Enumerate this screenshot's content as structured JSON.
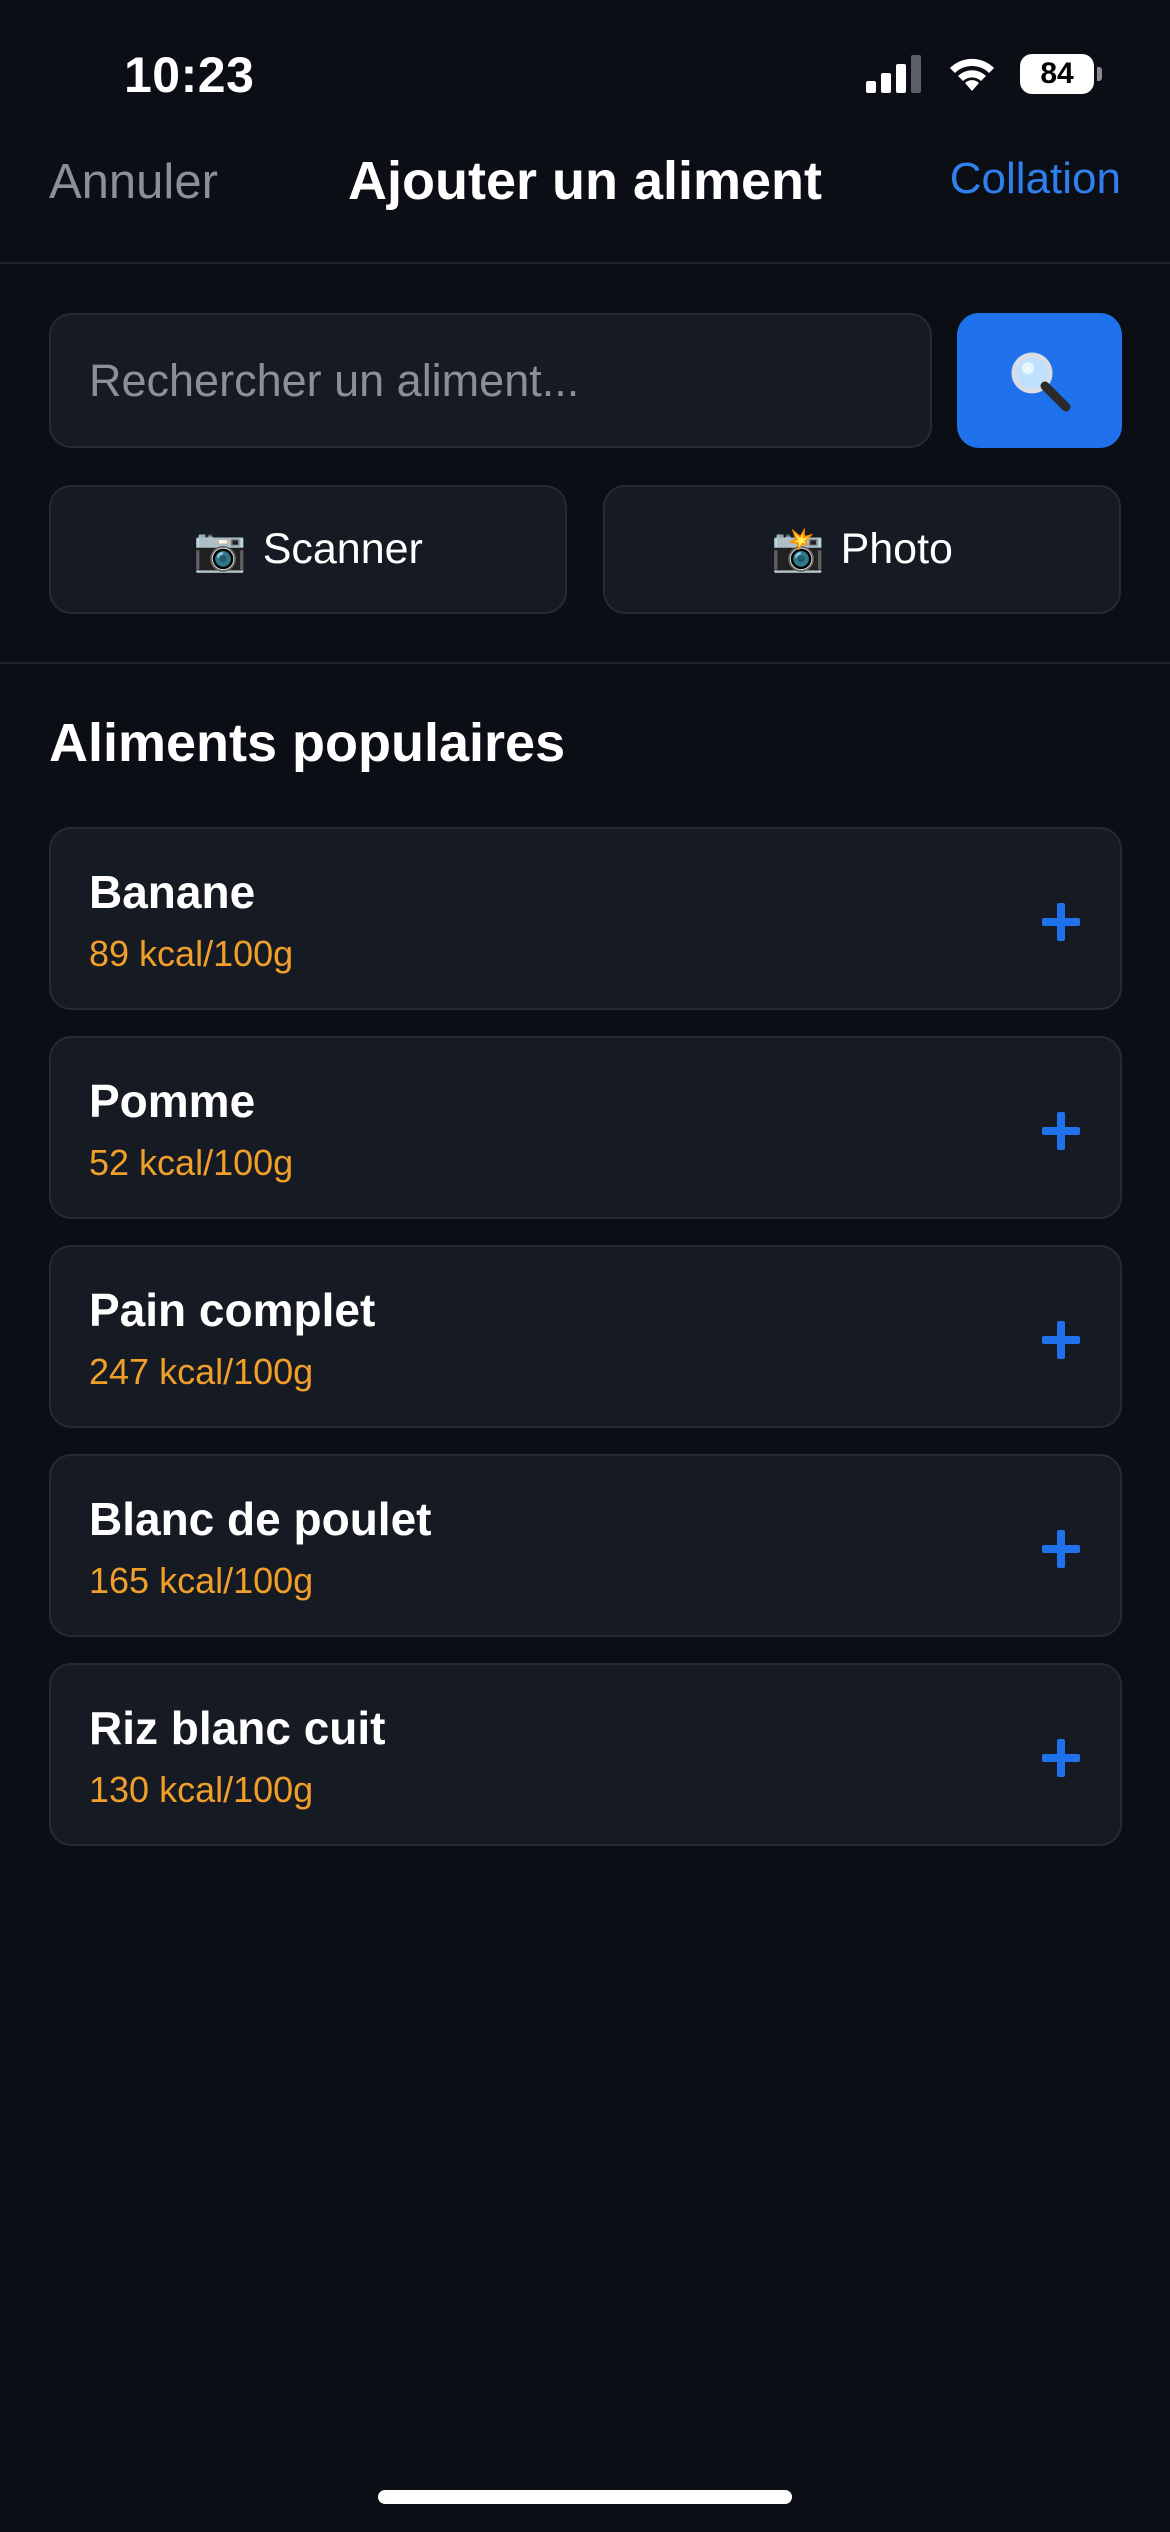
{
  "status_bar": {
    "time": "10:23",
    "battery": "84",
    "battery_level_percent": 84
  },
  "nav": {
    "cancel_label": "Annuler",
    "title": "Ajouter un aliment",
    "action_label": "Collation"
  },
  "search": {
    "placeholder": "Rechercher un aliment...",
    "value": "",
    "button_icon": "search-icon"
  },
  "actions": {
    "scanner": {
      "icon": "📷",
      "label": "Scanner"
    },
    "photo": {
      "icon": "📸",
      "label": "Photo"
    }
  },
  "popular": {
    "title": "Aliments populaires",
    "items": [
      {
        "name": "Banane",
        "kcal": "89 kcal/100g"
      },
      {
        "name": "Pomme",
        "kcal": "52 kcal/100g"
      },
      {
        "name": "Pain complet",
        "kcal": "247 kcal/100g"
      },
      {
        "name": "Blanc de poulet",
        "kcal": "165 kcal/100g"
      },
      {
        "name": "Riz blanc cuit",
        "kcal": "130 kcal/100g"
      }
    ]
  },
  "colors": {
    "background": "#0b0e15",
    "accent": "#1f72ec",
    "link": "#2f80ed",
    "calories": "#f0a02a"
  }
}
